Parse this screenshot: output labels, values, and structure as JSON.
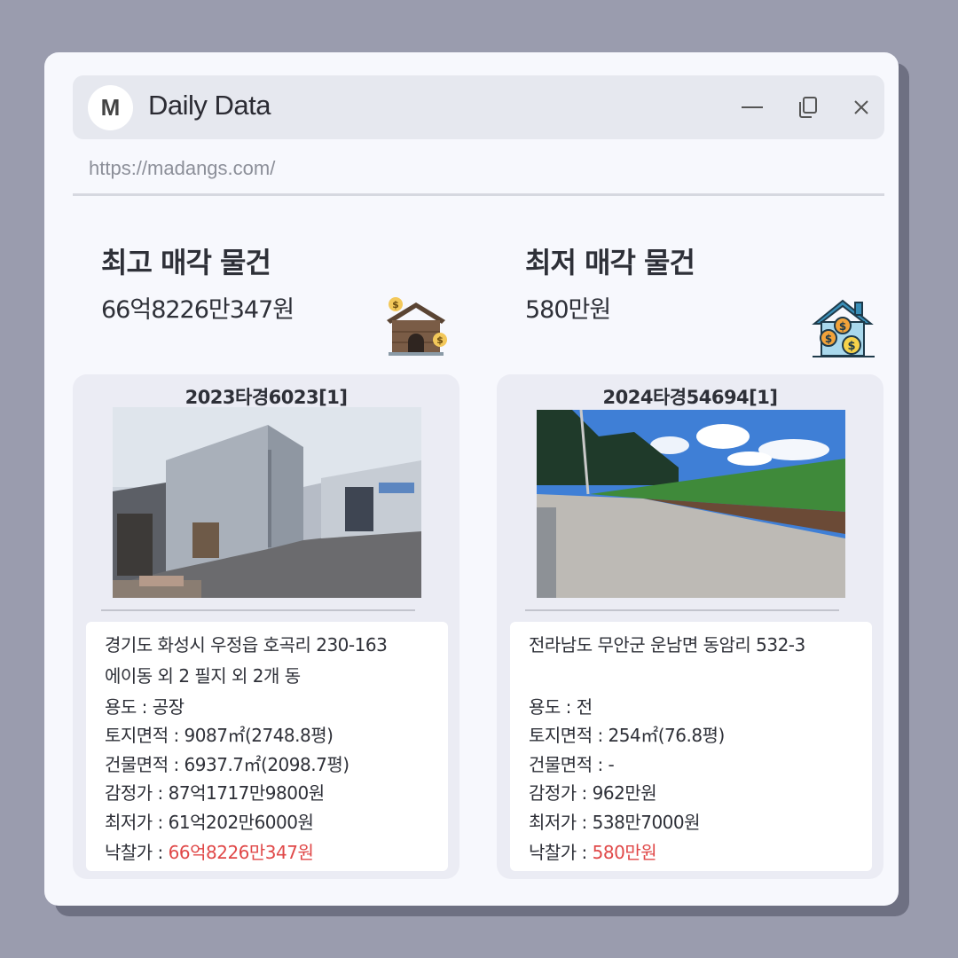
{
  "window": {
    "logo_letter": "M",
    "title": "Daily Data",
    "url": "https://madangs.com/",
    "controls": [
      "minimize-icon",
      "duplicate-icon",
      "close-icon"
    ]
  },
  "highest": {
    "heading": "최고 매각 물건",
    "amount": "66억8226만347원",
    "icon": "house-money-icon",
    "case_no": "2023타경6023[1]",
    "photo": "factory-building-photo",
    "address_line1": "경기도 화성시 우정읍 호곡리 230-163",
    "address_line2": "에이동 외 2 필지 외 2개 동",
    "usage": "용도 : 공장",
    "land_area": "토지면적 : 9087㎡(2748.8평)",
    "building_area": "건물면적 : 6937.7㎡(2098.7평)",
    "appraisal": "감정가 : 87억1717만9800원",
    "minimum": "최저가 : 61억202만6000원",
    "winning_label": "낙찰가 : ",
    "winning_value": "66억8226만347원"
  },
  "lowest": {
    "heading": "최저 매각 물건",
    "amount": "580만원",
    "icon": "house-coins-icon",
    "case_no": "2024타경54694[1]",
    "photo": "farmland-road-photo",
    "address_line1": "전라남도 무안군 운남면 동암리 532-3",
    "usage": "용도 :  전",
    "land_area": "토지면적 : 254㎡(76.8평)",
    "building_area": "건물면적 : -",
    "appraisal": "감정가 : 962만원",
    "minimum": "최저가 : 538만7000원",
    "winning_label": "낙찰가 : ",
    "winning_value": "580만원"
  },
  "colors": {
    "background": "#9a9cae",
    "window": "#f7f8fd",
    "titlebar": "#e6e8ef",
    "card": "#ebecf4",
    "highlight": "#e04848"
  }
}
